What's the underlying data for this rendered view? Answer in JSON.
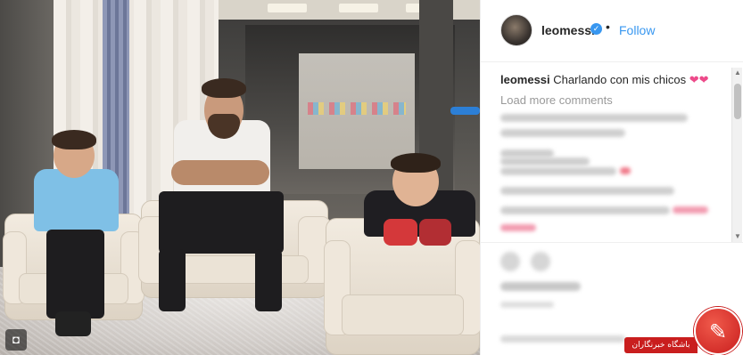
{
  "post": {
    "username": "leomessi",
    "verified_mark": "✓",
    "separator": "•",
    "follow_label": "Follow"
  },
  "caption": {
    "username": "leomessi",
    "text": "Charlando con mis chicos",
    "emoji": "❤❤"
  },
  "comments": {
    "load_more_label": "Load more comments"
  },
  "photo": {
    "badge_icon": "instagram-camera-icon",
    "badge_glyph": "◘"
  },
  "watermark": {
    "label": "باشگاه خبرنگاران"
  },
  "colors": {
    "follow_blue": "#3897f0",
    "verified_blue": "#3897f0",
    "heart_pink": "#ed4a8a",
    "watermark_red": "#c91e1e"
  }
}
